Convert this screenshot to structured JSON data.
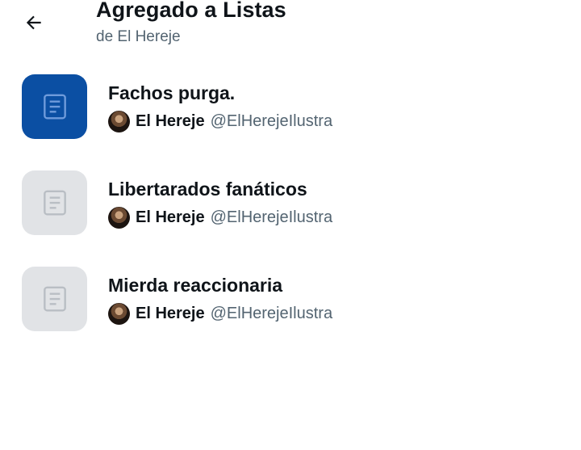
{
  "header": {
    "back_icon": "arrow-left-icon",
    "title": "Agregado a Listas",
    "subtitle": "de El Hereje"
  },
  "lists": [
    {
      "name": "Fachos purga.",
      "owner_name": "El Hereje",
      "owner_handle": "@ElHerejeIlustra",
      "thumb_color": "#0b4fa3",
      "icon_color": "#6f9bdb",
      "icon": "list-document-icon"
    },
    {
      "name": "Libertarados fanáticos",
      "owner_name": "El Hereje",
      "owner_handle": "@ElHerejeIlustra",
      "thumb_color": "#e1e3e6",
      "icon_color": "#b9bec4",
      "icon": "list-document-icon"
    },
    {
      "name": "Mierda reaccionaria",
      "owner_name": "El Hereje",
      "owner_handle": "@ElHerejeIlustra",
      "thumb_color": "#e1e3e6",
      "icon_color": "#b9bec4",
      "icon": "list-document-icon"
    }
  ]
}
